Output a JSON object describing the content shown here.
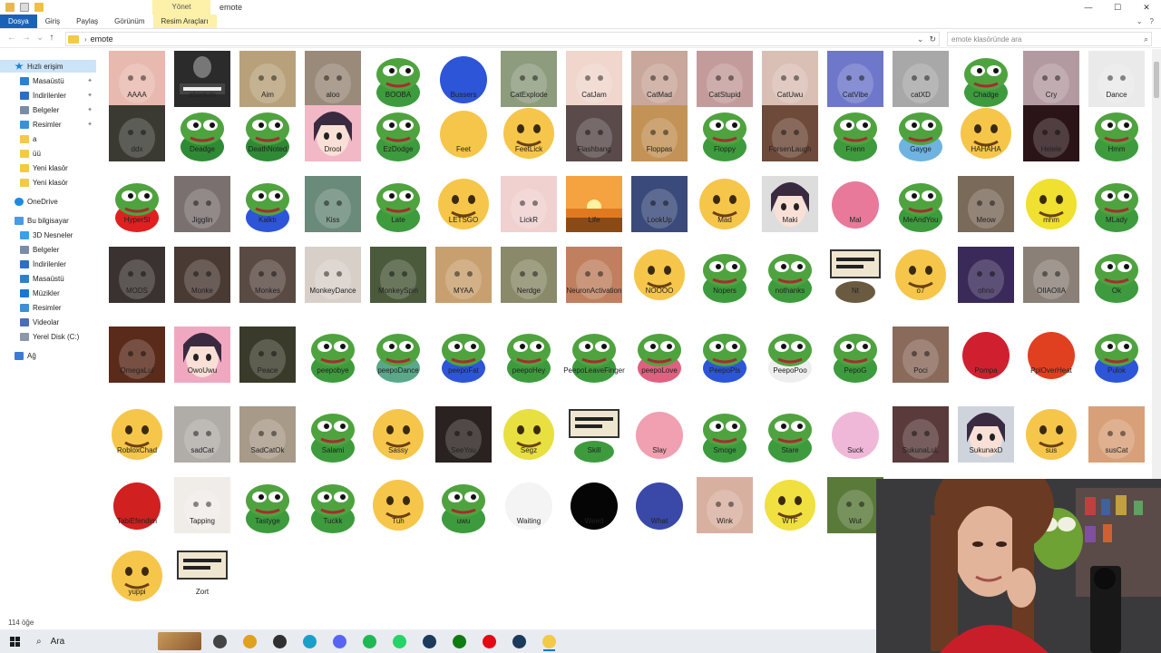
{
  "window": {
    "title": "emote",
    "manage_tab": "Yönet",
    "controls": [
      "—",
      "☐",
      "✕"
    ]
  },
  "ribbon": {
    "tabs": [
      {
        "label": "Dosya",
        "style": "file"
      },
      {
        "label": "Giriş",
        "style": ""
      },
      {
        "label": "Paylaş",
        "style": ""
      },
      {
        "label": "Görünüm",
        "style": ""
      },
      {
        "label": "Resim Araçları",
        "style": "manage"
      }
    ]
  },
  "address": {
    "path": "emote",
    "search_placeholder": "emote klasöründe ara"
  },
  "sidebar": {
    "items": [
      {
        "label": "Hızlı erişim",
        "icon": "star-icon",
        "cls": "ic-star",
        "indent": 16,
        "selected": true,
        "pinned": false,
        "gap": 0
      },
      {
        "label": "Masaüstü",
        "icon": "desktop-icon",
        "cls": "ic-blue",
        "indent": 22,
        "selected": false,
        "pinned": true,
        "gap": 0
      },
      {
        "label": "İndirilenler",
        "icon": "download-icon",
        "cls": "ic-down",
        "indent": 22,
        "selected": false,
        "pinned": true,
        "gap": 0
      },
      {
        "label": "Belgeler",
        "icon": "documents-icon",
        "cls": "ic-docs",
        "indent": 22,
        "selected": false,
        "pinned": true,
        "gap": 0
      },
      {
        "label": "Resimler",
        "icon": "pictures-icon",
        "cls": "ic-pics",
        "indent": 22,
        "selected": false,
        "pinned": true,
        "gap": 0
      },
      {
        "label": "a",
        "icon": "folder-icon",
        "cls": "ic-folder",
        "indent": 22,
        "selected": false,
        "pinned": false,
        "gap": 0
      },
      {
        "label": "üü",
        "icon": "folder-icon",
        "cls": "ic-folder",
        "indent": 22,
        "selected": false,
        "pinned": false,
        "gap": 0
      },
      {
        "label": "Yeni klasör",
        "icon": "folder-icon",
        "cls": "ic-folder",
        "indent": 22,
        "selected": false,
        "pinned": false,
        "gap": 0
      },
      {
        "label": "Yeni klasör",
        "icon": "folder-icon",
        "cls": "ic-folder",
        "indent": 22,
        "selected": false,
        "pinned": false,
        "gap": 0
      },
      {
        "label": "OneDrive",
        "icon": "cloud-icon",
        "cls": "ic-cloud",
        "indent": 16,
        "selected": false,
        "pinned": false,
        "gap": 1
      },
      {
        "label": "Bu bilgisayar",
        "icon": "computer-icon",
        "cls": "ic-pc",
        "indent": 16,
        "selected": false,
        "pinned": false,
        "gap": 1
      },
      {
        "label": "3D Nesneler",
        "icon": "cube-icon",
        "cls": "ic-3d",
        "indent": 22,
        "selected": false,
        "pinned": false,
        "gap": 0
      },
      {
        "label": "Belgeler",
        "icon": "documents-icon",
        "cls": "ic-docs",
        "indent": 22,
        "selected": false,
        "pinned": false,
        "gap": 0
      },
      {
        "label": "İndirilenler",
        "icon": "download-icon",
        "cls": "ic-down",
        "indent": 22,
        "selected": false,
        "pinned": false,
        "gap": 0
      },
      {
        "label": "Masaüstü",
        "icon": "desktop-icon",
        "cls": "ic-blue",
        "indent": 22,
        "selected": false,
        "pinned": false,
        "gap": 0
      },
      {
        "label": "Müzikler",
        "icon": "music-icon",
        "cls": "ic-music",
        "indent": 22,
        "selected": false,
        "pinned": false,
        "gap": 0
      },
      {
        "label": "Resimler",
        "icon": "pictures-icon",
        "cls": "ic-pics",
        "indent": 22,
        "selected": false,
        "pinned": false,
        "gap": 0
      },
      {
        "label": "Videolar",
        "icon": "video-icon",
        "cls": "ic-video",
        "indent": 22,
        "selected": false,
        "pinned": false,
        "gap": 0
      },
      {
        "label": "Yerel Disk (C:)",
        "icon": "disk-icon",
        "cls": "ic-disk",
        "indent": 22,
        "selected": false,
        "pinned": false,
        "gap": 0
      },
      {
        "label": "Ağ",
        "icon": "network-icon",
        "cls": "ic-net",
        "indent": 16,
        "selected": false,
        "pinned": false,
        "gap": 1
      }
    ]
  },
  "files": {
    "rows": [
      [
        {
          "name": "AAAA",
          "kind": "photo",
          "color": "#e8b9ae"
        },
        {
          "name": "absolute",
          "kind": "poster",
          "color": "#2b2b2b"
        },
        {
          "name": "Aim",
          "kind": "photo",
          "color": "#b8a17a"
        },
        {
          "name": "aloo",
          "kind": "photo",
          "color": "#9a8a7a"
        },
        {
          "name": "BOOBA",
          "kind": "pepe",
          "color": "#3d9b3d"
        },
        {
          "name": "Bussers",
          "kind": "blob",
          "color": "#2d55d8"
        },
        {
          "name": "CatExplode",
          "kind": "photo",
          "color": "#8d9c7d"
        },
        {
          "name": "CatJam",
          "kind": "photo",
          "color": "#f0d6cc"
        },
        {
          "name": "CatMad",
          "kind": "photo",
          "color": "#c9a79a"
        },
        {
          "name": "CatStupid",
          "kind": "photo",
          "color": "#c49b9b"
        },
        {
          "name": "CatUwu",
          "kind": "photo",
          "color": "#d9bfb4"
        },
        {
          "name": "CatVibe",
          "kind": "photo",
          "color": "#6e77c9"
        },
        {
          "name": "catXD",
          "kind": "photo",
          "color": "#a8a8a8"
        },
        {
          "name": "Chadge",
          "kind": "pepe",
          "color": "#3d9b3d"
        },
        {
          "name": "Cry",
          "kind": "photo",
          "color": "#b39aa0"
        },
        {
          "name": "Dance",
          "kind": "photo",
          "color": "#eaeaea"
        }
      ],
      [
        {
          "name": "ddx",
          "kind": "photo",
          "color": "#3a3a32"
        },
        {
          "name": "Deadge",
          "kind": "pepe",
          "color": "#2f8a35"
        },
        {
          "name": "DeathNoted",
          "kind": "pepe",
          "color": "#2f8a35"
        },
        {
          "name": "Drool",
          "kind": "anime",
          "color": "#f2b8c6"
        },
        {
          "name": "EzDodge",
          "kind": "pepe",
          "color": "#3d9b3d"
        },
        {
          "name": "Feet",
          "kind": "blob",
          "color": "#f6c64a"
        },
        {
          "name": "FeetLick",
          "kind": "emoji",
          "color": "#f6c64a"
        },
        {
          "name": "Flashbang",
          "kind": "photo",
          "color": "#5a4a4a"
        },
        {
          "name": "Floppas",
          "kind": "photo",
          "color": "#c29256"
        },
        {
          "name": "Floppy",
          "kind": "pepe",
          "color": "#3d9b3d"
        },
        {
          "name": "ForsenLaugh",
          "kind": "photo",
          "color": "#6e4a3a"
        },
        {
          "name": "Frenn",
          "kind": "pepe",
          "color": "#3d9b3d"
        },
        {
          "name": "Gayge",
          "kind": "pepe",
          "color": "#6fb3e0"
        },
        {
          "name": "HAHAHA",
          "kind": "emoji",
          "color": "#f6c64a"
        },
        {
          "name": "Helele",
          "kind": "photo",
          "color": "#2a1418"
        },
        {
          "name": "Hmm",
          "kind": "pepe",
          "color": "#3d9b3d"
        }
      ],
      [
        {
          "name": "HyperSl",
          "kind": "pepe",
          "color": "#e02020"
        },
        {
          "name": "Jigglin",
          "kind": "photo",
          "color": "#7a7070"
        },
        {
          "name": "Kalktı",
          "kind": "pepe",
          "color": "#2d55d8"
        },
        {
          "name": "Kiss",
          "kind": "photo",
          "color": "#6a8a7a"
        },
        {
          "name": "Late",
          "kind": "pepe",
          "color": "#3d9b3d"
        },
        {
          "name": "LETSGO",
          "kind": "emoji",
          "color": "#f6c64a"
        },
        {
          "name": "LickR",
          "kind": "photo",
          "color": "#f1d0d0"
        },
        {
          "name": "Life",
          "kind": "sunset",
          "color": "#f0a030"
        },
        {
          "name": "LookUp",
          "kind": "photo",
          "color": "#3a4a7a"
        },
        {
          "name": "Mad",
          "kind": "emoji",
          "color": "#f6c64a"
        },
        {
          "name": "Maki",
          "kind": "anime",
          "color": "#dddddd"
        },
        {
          "name": "Mal",
          "kind": "blob",
          "color": "#e8799a"
        },
        {
          "name": "MeAndYou",
          "kind": "pepe",
          "color": "#3d9b3d"
        },
        {
          "name": "Meow",
          "kind": "photo",
          "color": "#7a6a5a"
        },
        {
          "name": "mhm",
          "kind": "emoji",
          "color": "#f0e030"
        },
        {
          "name": "MLady",
          "kind": "pepe",
          "color": "#3d9b3d"
        }
      ],
      [
        {
          "name": "MODS",
          "kind": "photo",
          "color": "#3a3230"
        },
        {
          "name": "Monke",
          "kind": "photo",
          "color": "#4a3a34"
        },
        {
          "name": "Monkes",
          "kind": "photo",
          "color": "#5a4a44"
        },
        {
          "name": "MonkeyDance",
          "kind": "photo",
          "color": "#d8d0c8"
        },
        {
          "name": "MonkeySpin",
          "kind": "photo",
          "color": "#4a5a3a"
        },
        {
          "name": "MYAA",
          "kind": "photo",
          "color": "#c8a070"
        },
        {
          "name": "Nerdge",
          "kind": "photo",
          "color": "#8a8a6a"
        },
        {
          "name": "NeuronActivation",
          "kind": "photo",
          "color": "#c08060"
        },
        {
          "name": "NOOOO",
          "kind": "emoji",
          "color": "#f6c64a"
        },
        {
          "name": "Nopers",
          "kind": "pepe",
          "color": "#3d9b3d"
        },
        {
          "name": "nothanks",
          "kind": "pepe",
          "color": "#3d9b3d"
        },
        {
          "name": "Nt",
          "kind": "sign",
          "color": "#6a5a40"
        },
        {
          "name": "o7",
          "kind": "emoji",
          "color": "#f6c64a"
        },
        {
          "name": "ohno",
          "kind": "photo",
          "color": "#3a2a5a"
        },
        {
          "name": "OIIAOIIA",
          "kind": "photo",
          "color": "#8a8078"
        },
        {
          "name": "Ok",
          "kind": "pepe",
          "color": "#3d9b3d"
        }
      ],
      [
        {
          "name": "OmegaLul",
          "kind": "photo",
          "color": "#5a2a1a"
        },
        {
          "name": "OwoUwu",
          "kind": "anime",
          "color": "#f0a8c0"
        },
        {
          "name": "Peace",
          "kind": "photo",
          "color": "#3a3a2a"
        },
        {
          "name": "peepobye",
          "kind": "pepe",
          "color": "#3d9b3d"
        },
        {
          "name": "peepoDance",
          "kind": "pepe",
          "color": "#5aa88a"
        },
        {
          "name": "peepoFat",
          "kind": "pepe",
          "color": "#2d55d8"
        },
        {
          "name": "peepoHey",
          "kind": "pepe",
          "color": "#3d9b3d"
        },
        {
          "name": "PeepoLeaveFinger",
          "kind": "pepe",
          "color": "#3d9b3d"
        },
        {
          "name": "peepoLove",
          "kind": "pepe",
          "color": "#e06080"
        },
        {
          "name": "PeepoPls",
          "kind": "pepe",
          "color": "#2d55d8"
        },
        {
          "name": "PeepoPoo",
          "kind": "pepe",
          "color": "#eeeeee"
        },
        {
          "name": "PepoG",
          "kind": "pepe",
          "color": "#3d9b3d"
        },
        {
          "name": "Poci",
          "kind": "photo",
          "color": "#8a6a5a"
        },
        {
          "name": "Pompa",
          "kind": "blob",
          "color": "#d02030"
        },
        {
          "name": "PplOverHeat",
          "kind": "blob",
          "color": "#e04020"
        },
        {
          "name": "Pulok",
          "kind": "pepe",
          "color": "#2d55d8"
        }
      ],
      [
        {
          "name": "RobloxChad",
          "kind": "emoji",
          "color": "#f6c64a"
        },
        {
          "name": "sadCat",
          "kind": "photo",
          "color": "#b0aca8"
        },
        {
          "name": "SadCatOk",
          "kind": "photo",
          "color": "#a89a88"
        },
        {
          "name": "Salami",
          "kind": "pepe",
          "color": "#3d9b3d"
        },
        {
          "name": "Sassy",
          "kind": "emoji",
          "color": "#f6c64a"
        },
        {
          "name": "SeeYou",
          "kind": "photo",
          "color": "#2a2220"
        },
        {
          "name": "Segz",
          "kind": "emoji",
          "color": "#e8e040"
        },
        {
          "name": "Skill",
          "kind": "sign",
          "color": "#3d9b3d"
        },
        {
          "name": "Slay",
          "kind": "blob",
          "color": "#f0a0b0"
        },
        {
          "name": "Smoge",
          "kind": "pepe",
          "color": "#3d9b3d"
        },
        {
          "name": "Stare",
          "kind": "pepe",
          "color": "#3d9b3d"
        },
        {
          "name": "Suck",
          "kind": "blob",
          "color": "#f0b8d8"
        },
        {
          "name": "SukunaLuL",
          "kind": "photo",
          "color": "#5a3a3a"
        },
        {
          "name": "SukunaxD",
          "kind": "anime",
          "color": "#cfd4dc"
        },
        {
          "name": "sus",
          "kind": "emoji",
          "color": "#f6c64a"
        },
        {
          "name": "susCat",
          "kind": "photo",
          "color": "#d8a078"
        }
      ],
      [
        {
          "name": "TabiEfendim",
          "kind": "blob",
          "color": "#d02020"
        },
        {
          "name": "Tapping",
          "kind": "photo",
          "color": "#f0ece8"
        },
        {
          "name": "Tastyge",
          "kind": "pepe",
          "color": "#3d9b3d"
        },
        {
          "name": "Tuckk",
          "kind": "pepe",
          "color": "#3d9b3d"
        },
        {
          "name": "Tuh",
          "kind": "emoji",
          "color": "#f6c64a"
        },
        {
          "name": "uwu",
          "kind": "pepe",
          "color": "#3d9b3d"
        },
        {
          "name": "Waiting",
          "kind": "blob",
          "color": "#f4f4f4"
        },
        {
          "name": "Weird",
          "kind": "blob",
          "color": "#050505"
        },
        {
          "name": "What",
          "kind": "blob",
          "color": "#3a48a8"
        },
        {
          "name": "Wink",
          "kind": "photo",
          "color": "#d8b0a0"
        },
        {
          "name": "WTF",
          "kind": "emoji",
          "color": "#f0e040"
        },
        {
          "name": "Wut",
          "kind": "photo",
          "color": "#5a7a3a"
        }
      ],
      [
        {
          "name": "yuppi",
          "kind": "emoji",
          "color": "#f6c64a"
        },
        {
          "name": "Zort",
          "kind": "sign",
          "color": "#ffffff"
        }
      ]
    ]
  },
  "status": {
    "item_count": "114 öğe"
  },
  "taskbar": {
    "search_label": "Ara",
    "apps": [
      {
        "name": "task-view-icon",
        "color": "#444444"
      },
      {
        "name": "chrome-icon",
        "color": "#e0a020"
      },
      {
        "name": "obs-icon",
        "color": "#303030"
      },
      {
        "name": "edge-icon",
        "color": "#1aa0c8"
      },
      {
        "name": "discord-icon",
        "color": "#5865f2"
      },
      {
        "name": "spotify-icon",
        "color": "#1db954"
      },
      {
        "name": "whatsapp-icon",
        "color": "#25d366"
      },
      {
        "name": "steam-icon",
        "color": "#1b3a5c"
      },
      {
        "name": "xbox-icon",
        "color": "#107c10"
      },
      {
        "name": "netflix-icon",
        "color": "#e50914"
      },
      {
        "name": "steam-icon",
        "color": "#1b3a5c"
      },
      {
        "name": "file-explorer-icon",
        "color": "#f3c948"
      }
    ]
  }
}
